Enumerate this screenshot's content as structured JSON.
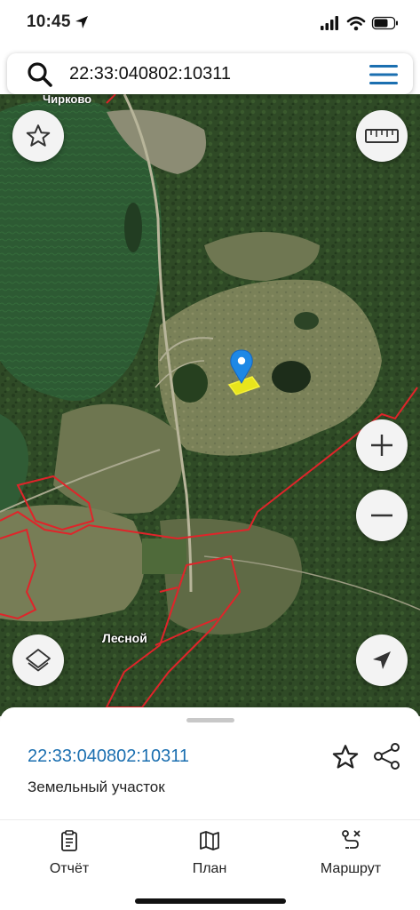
{
  "status": {
    "time": "10:45"
  },
  "search": {
    "query": "22:33:040802:10311"
  },
  "map": {
    "place_label": "Лесной",
    "top_label": "Чирково"
  },
  "sheet": {
    "parcel_id": "22:33:040802:10311",
    "parcel_type": "Земельный участок"
  },
  "tabs": [
    {
      "label": "Отчёт",
      "icon": "report-icon"
    },
    {
      "label": "План",
      "icon": "map-plan-icon"
    },
    {
      "label": "Маршрут",
      "icon": "route-icon"
    }
  ],
  "colors": {
    "accent": "#1b6fb0",
    "boundary": "#e0242a",
    "parcel": "#e8e51c",
    "pin": "#1e88e5"
  }
}
